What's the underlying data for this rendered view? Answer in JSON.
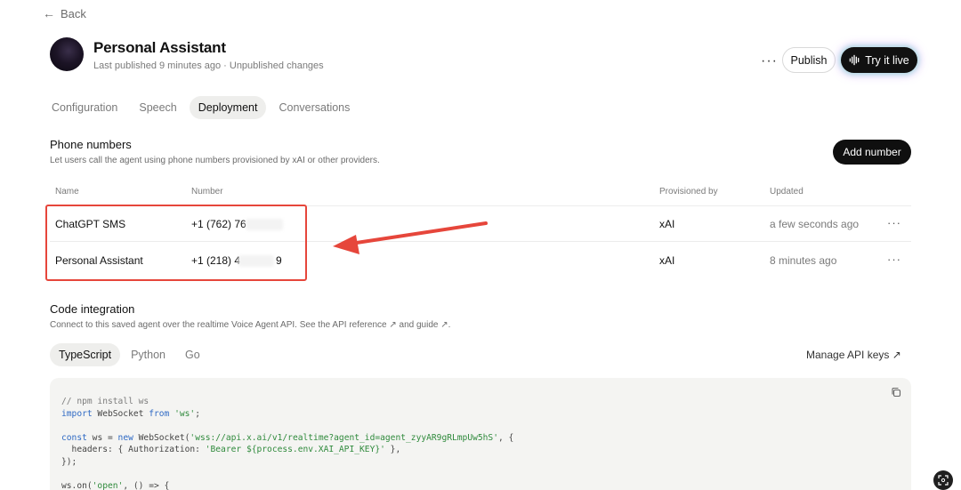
{
  "nav": {
    "back_label": "Back"
  },
  "agent": {
    "name": "Personal Assistant",
    "status": "Last published 9 minutes ago · Unpublished changes"
  },
  "actions": {
    "more": "···",
    "publish": "Publish",
    "try_live": "Try it live"
  },
  "tabs": [
    "Configuration",
    "Speech",
    "Deployment",
    "Conversations"
  ],
  "active_tab": "Deployment",
  "phone_numbers": {
    "title": "Phone numbers",
    "description": "Let users call the agent using phone numbers provisioned by xAI or other providers.",
    "add_button": "Add number",
    "columns": [
      "Name",
      "Number",
      "Provisioned by",
      "Updated"
    ],
    "rows": [
      {
        "name": "ChatGPT SMS",
        "number": "+1 (762) 76",
        "provider": "xAI",
        "updated": "a few seconds ago",
        "more": "···"
      },
      {
        "name": "Personal Assistant",
        "number": "+1 (218) 4",
        "number_suffix": "9",
        "provider": "xAI",
        "updated": "8 minutes ago",
        "more": "···"
      }
    ]
  },
  "code_integration": {
    "title": "Code integration",
    "description": "Connect to this saved agent over the realtime Voice Agent API. See the API reference ↗ and guide ↗.",
    "languages": [
      "TypeScript",
      "Python",
      "Go"
    ],
    "active_language": "TypeScript",
    "manage_keys": "Manage API keys ↗",
    "code_lines": [
      "// npm install ws",
      "import WebSocket from 'ws';",
      "",
      "const ws = new WebSocket('wss://api.x.ai/v1/realtime?agent_id=agent_zyyAR9gRLmpUw5hS', {",
      "  headers: { Authorization: 'Bearer ${process.env.XAI_API_KEY}' },",
      "});",
      "",
      "ws.on('open', () => {"
    ]
  },
  "colors": {
    "accent_dark": "#0f0f0f",
    "highlight": "#e6463b",
    "code_bg": "#f4f4f2"
  }
}
